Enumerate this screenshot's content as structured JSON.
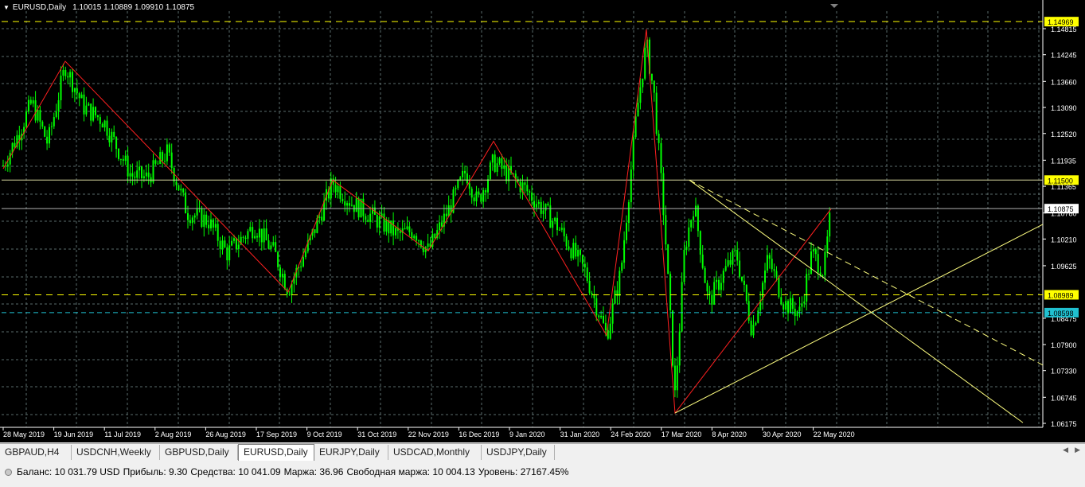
{
  "chart": {
    "symbol_timeframe": "EURUSD,Daily",
    "ohlc": "1.10015 1.10889 1.09910 1.10875",
    "price_labels": [
      "1.14815",
      "1.14245",
      "1.13660",
      "1.13090",
      "1.12520",
      "1.11935",
      "1.11365",
      "1.10780",
      "1.10210",
      "1.09625",
      "1.08475",
      "1.07900",
      "1.07330",
      "1.06745",
      "1.06175"
    ],
    "date_labels": [
      "28 May 2019",
      "19 Jun 2019",
      "11 Jul 2019",
      "2 Aug 2019",
      "26 Aug 2019",
      "17 Sep 2019",
      "9 Oct 2019",
      "31 Oct 2019",
      "22 Nov 2019",
      "16 Dec 2019",
      "9 Jan 2020",
      "31 Jan 2020",
      "24 Feb 2020",
      "17 Mar 2020",
      "8 Apr 2020",
      "30 Apr 2020",
      "22 May 2020"
    ],
    "level_tags": [
      {
        "text": "1.14969",
        "bg": "#ffff00",
        "fg": "#000000"
      },
      {
        "text": "1.11500",
        "bg": "#ffff00",
        "fg": "#000000"
      },
      {
        "text": "1.10875",
        "bg": "#ffffff",
        "fg": "#000000"
      },
      {
        "text": "1.08989",
        "bg": "#ffff00",
        "fg": "#000000"
      },
      {
        "text": "1.08598",
        "bg": "#20c0d0",
        "fg": "#000000"
      }
    ],
    "colors": {
      "background": "#000000",
      "grid": "#5a6b6b",
      "candle": "#00ff00",
      "zigzag": "#ff2020",
      "lines": "#ffff80",
      "axis_text": "#ffffff"
    }
  },
  "tabs": [
    "GBPAUD,H4",
    "USDCNH,Weekly",
    "GBPUSD,Daily",
    "EURUSD,Daily",
    "EURJPY,Daily",
    "USDCAD,Monthly",
    "USDJPY,Daily"
  ],
  "active_tab": "EURUSD,Daily",
  "status": {
    "balance": "Баланс: 10 031.79 USD",
    "profit": "Прибыль: 9.30",
    "equity": "Средства: 10 041.09",
    "margin": "Маржа: 36.96",
    "free_margin": "Свободная маржа: 10 004.13",
    "level": "Уровень: 27167.45%"
  }
}
